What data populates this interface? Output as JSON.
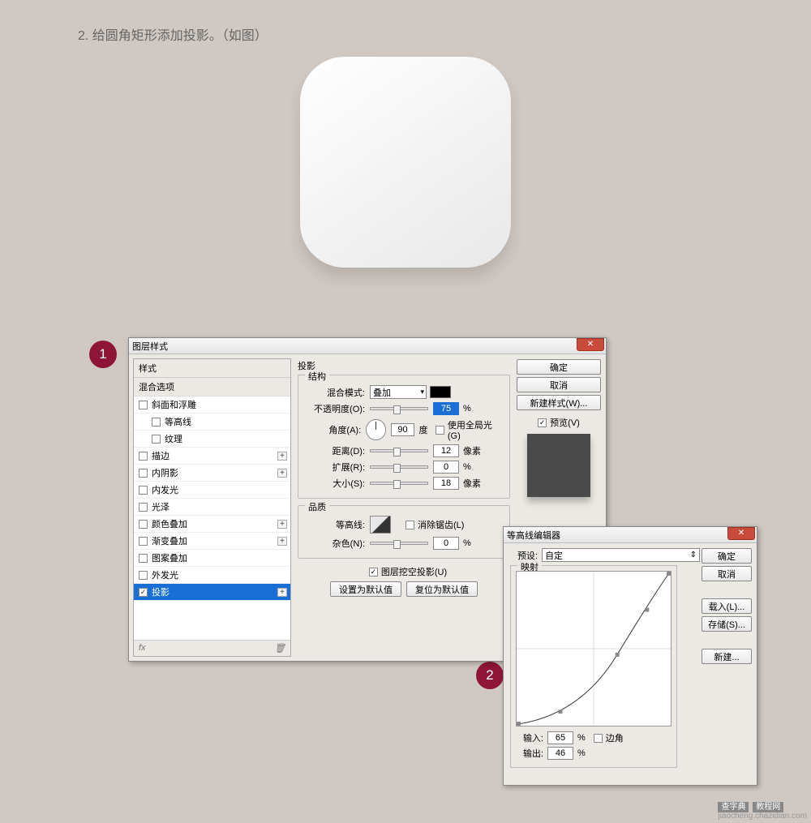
{
  "caption": "2. 给圆角矩形添加投影。（如图）",
  "badges": {
    "one": "1",
    "two": "2"
  },
  "dialog1": {
    "title": "图层样式",
    "sidebar": {
      "header": "样式",
      "subheader": "混合选项",
      "items": [
        {
          "label": "斜面和浮雕",
          "checked": false,
          "plus": false,
          "indent": false
        },
        {
          "label": "等高线",
          "checked": false,
          "plus": false,
          "indent": true
        },
        {
          "label": "纹理",
          "checked": false,
          "plus": false,
          "indent": true
        },
        {
          "label": "描边",
          "checked": false,
          "plus": true,
          "indent": false
        },
        {
          "label": "内阴影",
          "checked": false,
          "plus": true,
          "indent": false
        },
        {
          "label": "内发光",
          "checked": false,
          "plus": false,
          "indent": false
        },
        {
          "label": "光泽",
          "checked": false,
          "plus": false,
          "indent": false
        },
        {
          "label": "颜色叠加",
          "checked": false,
          "plus": true,
          "indent": false
        },
        {
          "label": "渐变叠加",
          "checked": false,
          "plus": true,
          "indent": false
        },
        {
          "label": "图案叠加",
          "checked": false,
          "plus": false,
          "indent": false
        },
        {
          "label": "外发光",
          "checked": false,
          "plus": false,
          "indent": false
        },
        {
          "label": "投影",
          "checked": true,
          "plus": true,
          "indent": false,
          "selected": true
        }
      ],
      "footer_left": "fx",
      "footer_trash": "🗑"
    },
    "main": {
      "panel_title": "投影",
      "structure_legend": "结构",
      "blend_label": "混合模式:",
      "blend_value": "叠加",
      "opacity_label": "不透明度(O):",
      "opacity_value": "75",
      "opacity_unit": "%",
      "angle_label": "角度(A):",
      "angle_value": "90",
      "angle_unit": "度",
      "global_light": "使用全局光(G)",
      "distance_label": "距离(D):",
      "distance_value": "12",
      "distance_unit": "像素",
      "spread_label": "扩展(R):",
      "spread_value": "0",
      "spread_unit": "%",
      "size_label": "大小(S):",
      "size_value": "18",
      "size_unit": "像素",
      "quality_legend": "品质",
      "contour_label": "等高线:",
      "antialias": "消除锯齿(L)",
      "noise_label": "杂色(N):",
      "noise_value": "0",
      "noise_unit": "%",
      "knockout": "图层挖空投影(U)",
      "make_default": "设置为默认值",
      "reset_default": "复位为默认值"
    },
    "buttons": {
      "ok": "确定",
      "cancel": "取消",
      "new_style": "新建样式(W)...",
      "preview": "预览(V)"
    }
  },
  "dialog2": {
    "title": "等高线编辑器",
    "preset_label": "预设:",
    "preset_value": "自定",
    "mapping_legend": "映射",
    "input_label": "输入:",
    "input_value": "65",
    "output_label": "输出:",
    "output_value": "46",
    "percent": "%",
    "corner": "边角",
    "buttons": {
      "ok": "确定",
      "cancel": "取消",
      "load": "载入(L)...",
      "save": "存储(S)...",
      "new": "新建..."
    }
  },
  "watermark": {
    "brand1": "查字典",
    "brand2": "教程网",
    "url": "jiaocheng.chazidian.com"
  }
}
